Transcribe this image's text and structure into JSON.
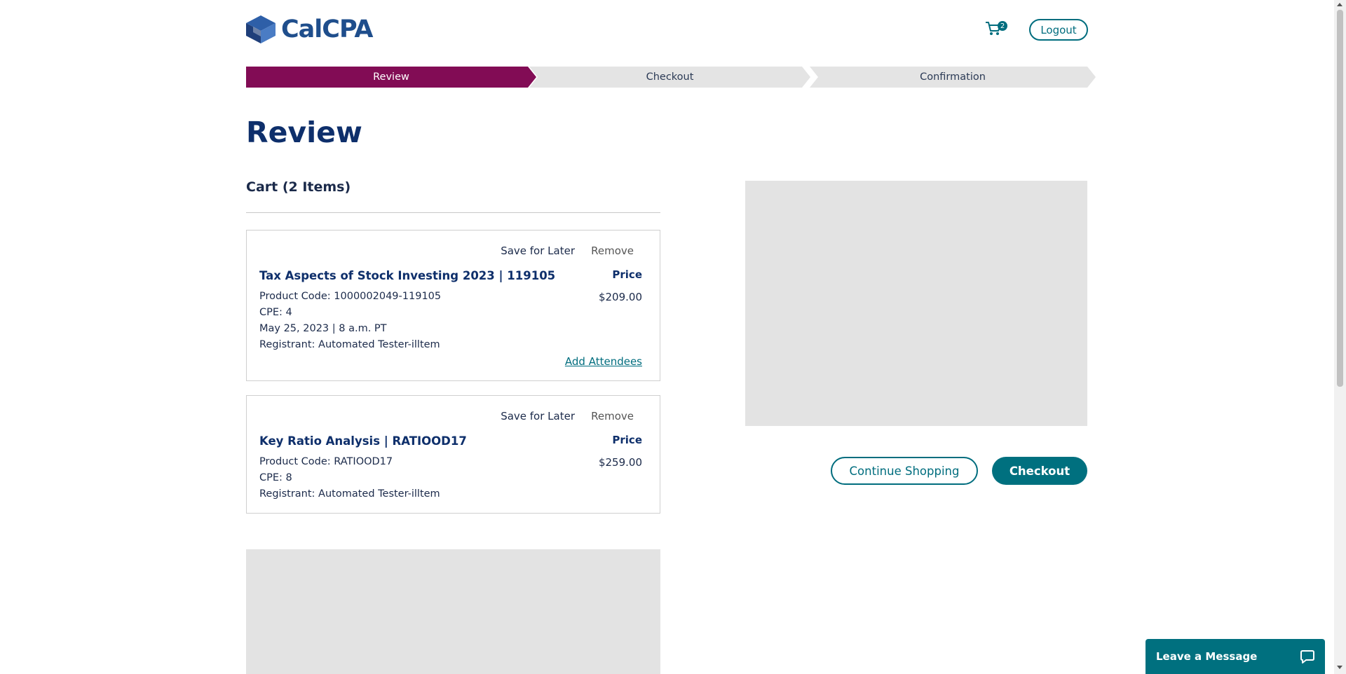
{
  "header": {
    "logo_text": "CalCPA",
    "cart_count": "2",
    "logout_label": "Logout"
  },
  "steps": [
    {
      "label": "Review",
      "state": "active"
    },
    {
      "label": "Checkout",
      "state": "inactive"
    },
    {
      "label": "Confirmation",
      "state": "inactive"
    }
  ],
  "page_title": "Review",
  "cart": {
    "heading": "Cart (2 Items)",
    "items": [
      {
        "save_for_later": "Save for Later",
        "remove": "Remove",
        "title": "Tax Aspects of Stock Investing 2023 | 119105",
        "price_label": "Price",
        "price": "$209.00",
        "product_code": "Product Code: 1000002049-119105",
        "cpe": "CPE: 4",
        "date": "May 25, 2023 | 8 a.m. PT",
        "registrant": "Registrant: Automated Tester-illtem",
        "add_attendees": "Add Attendees"
      },
      {
        "save_for_later": "Save for Later",
        "remove": "Remove",
        "title": "Key Ratio Analysis | RATIOOD17",
        "price_label": "Price",
        "price": "$259.00",
        "product_code": "Product Code: RATIOOD17",
        "cpe": "CPE: 8",
        "registrant": "Registrant: Automated Tester-illtem"
      }
    ]
  },
  "actions": {
    "continue_shopping": "Continue Shopping",
    "checkout": "Checkout"
  },
  "chat": {
    "label": "Leave a Message"
  },
  "colors": {
    "brand_blue": "#1f4e8c",
    "active_step": "#820c55",
    "teal": "#00707f"
  }
}
